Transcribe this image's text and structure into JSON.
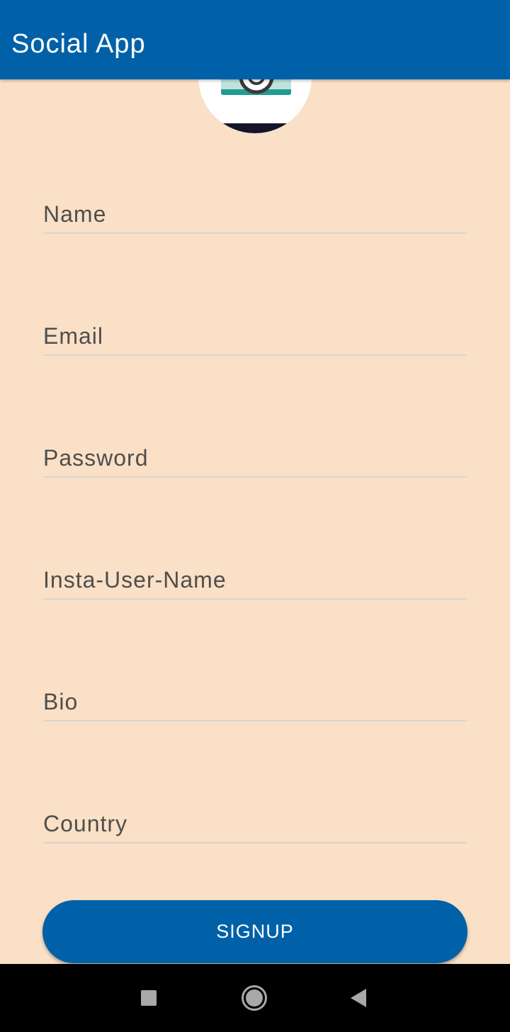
{
  "app_bar": {
    "title": "Social App",
    "color": "#0061A8"
  },
  "profile": {
    "avatar_icon": "camera-icon"
  },
  "form": {
    "fields": [
      {
        "label": "Name"
      },
      {
        "label": "Email"
      },
      {
        "label": "Password"
      },
      {
        "label": "Insta-User-Name"
      },
      {
        "label": "Bio"
      },
      {
        "label": "Country"
      }
    ],
    "submit_label": "SIGNUP"
  },
  "nav_bar": {
    "recents_icon": "square-icon",
    "home_icon": "circle-home-icon",
    "back_icon": "triangle-back-icon"
  },
  "colors": {
    "background": "#FAE0C6",
    "primary": "#0061A8"
  }
}
